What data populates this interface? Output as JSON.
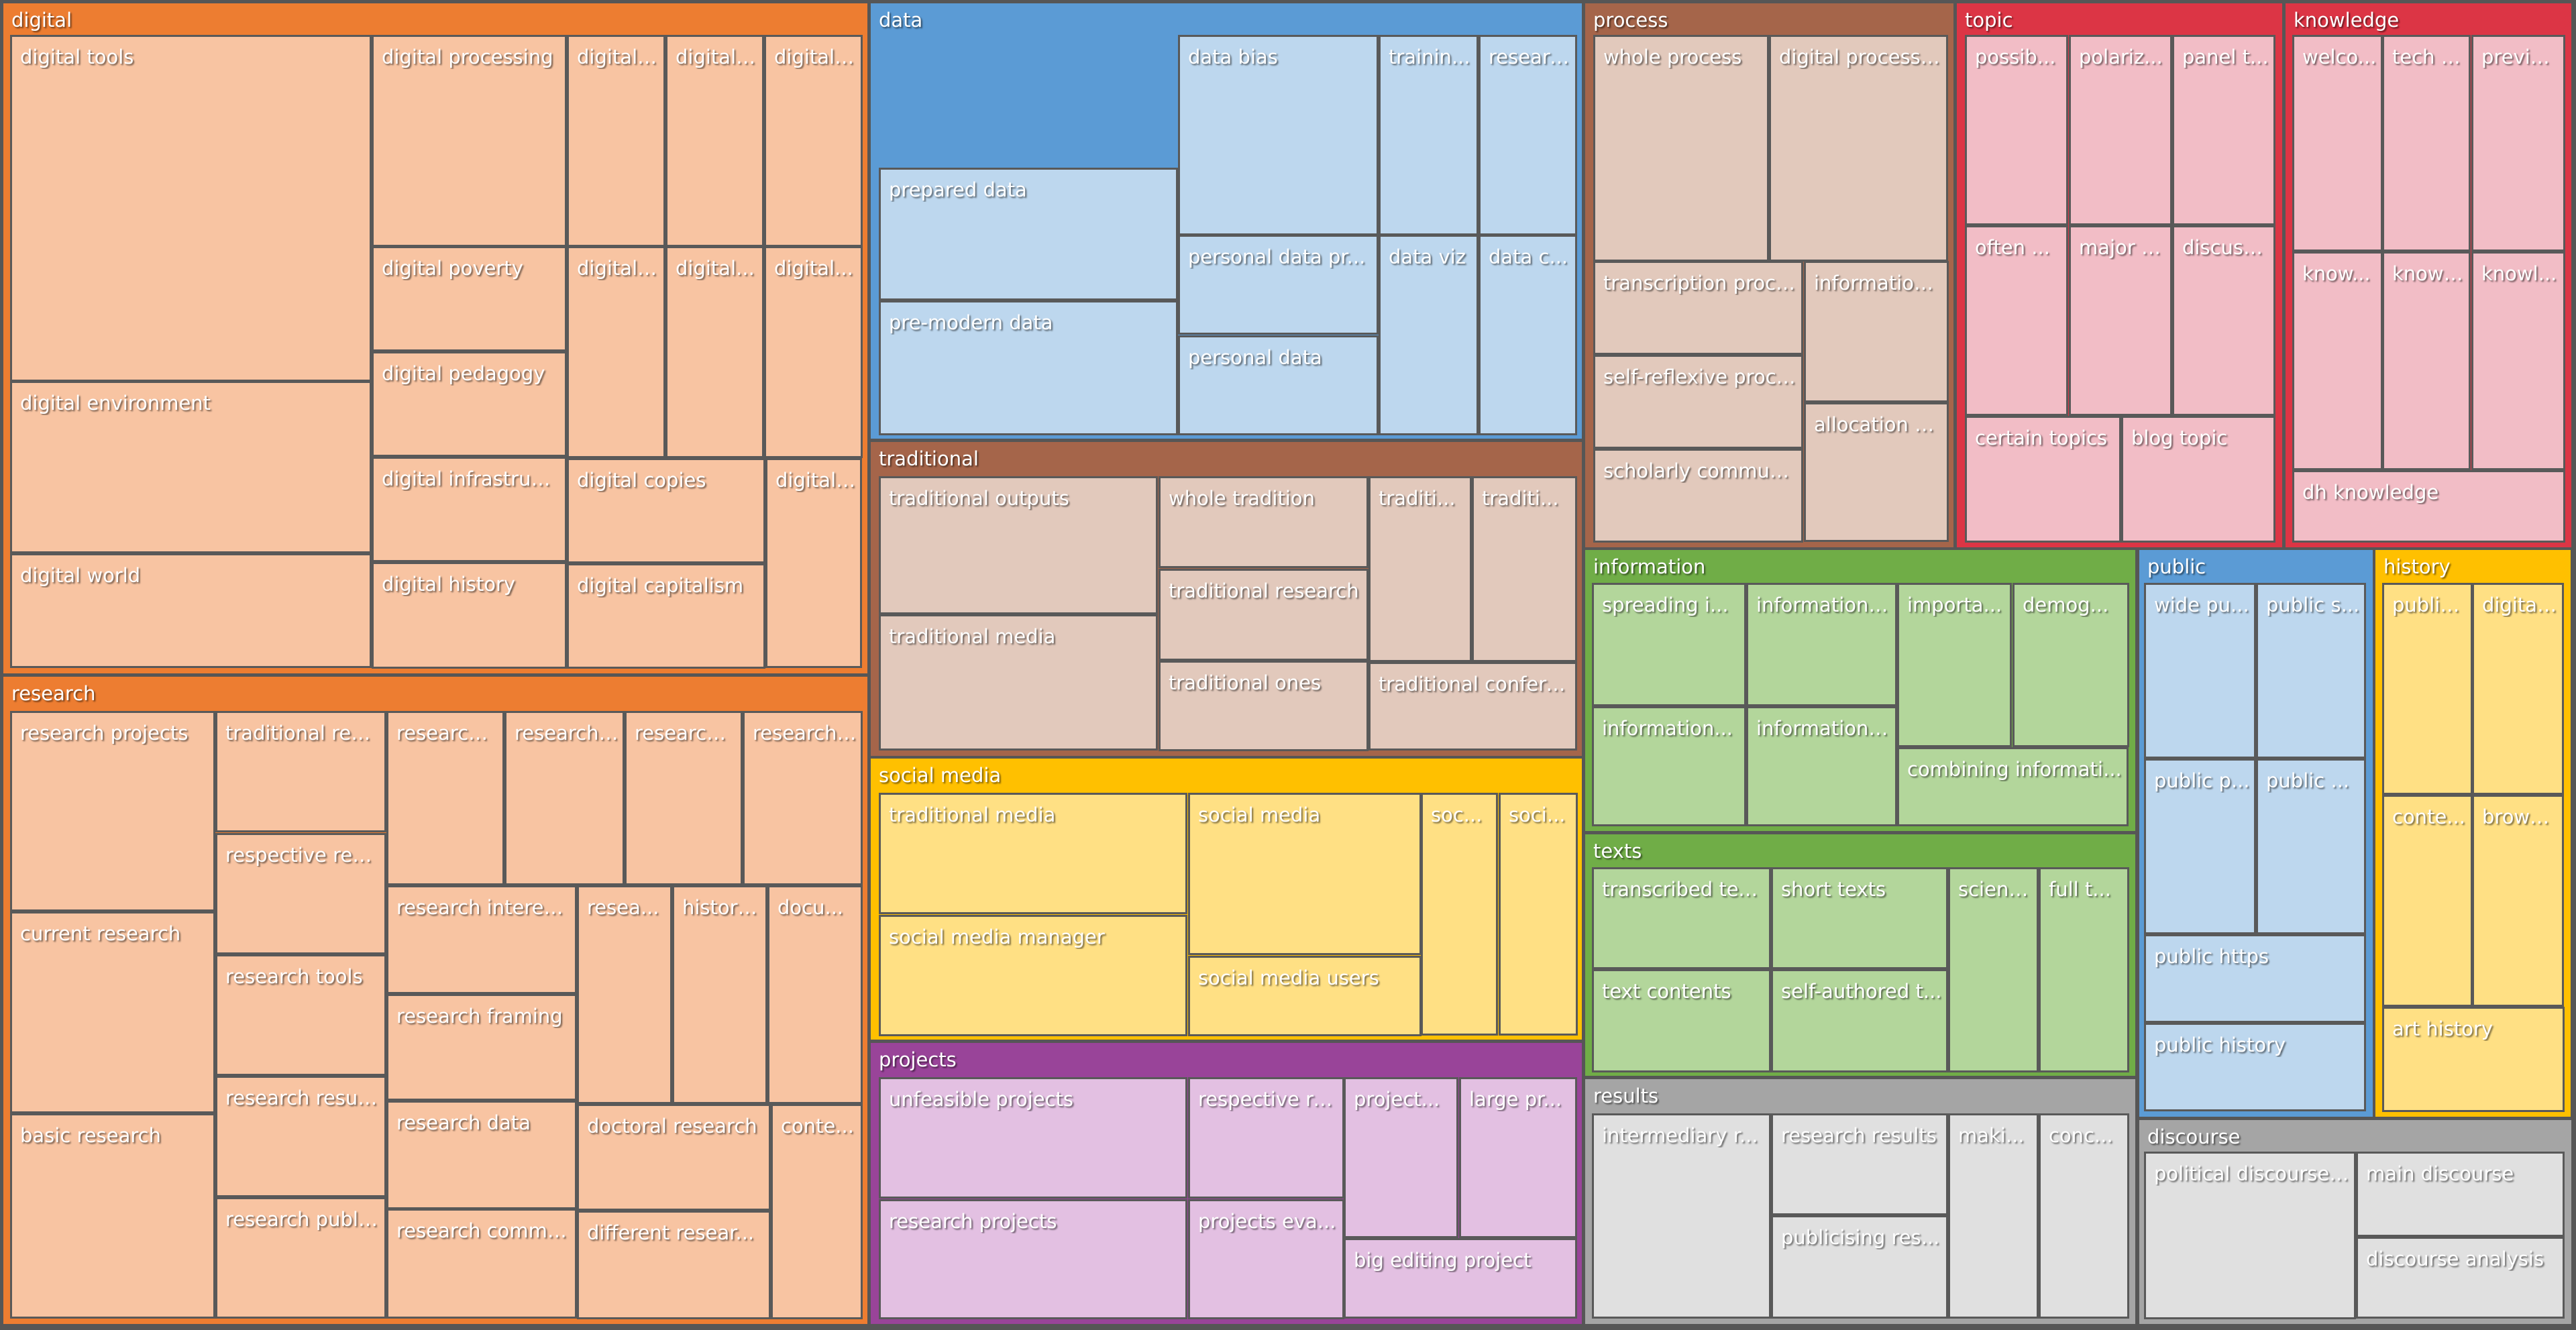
{
  "chart_data": {
    "type": "treemap",
    "title": "",
    "groups": [
      {
        "name": "digital",
        "color": "#ED7D31",
        "leaf_color": "#F8C4A2",
        "children": [
          "digital tools",
          "digital processing",
          "digital ...",
          "digital ...",
          "digital ...",
          "digital environment",
          "digital world",
          "digital poverty",
          "digital pedagogy",
          "digital infrastruct...",
          "digital history",
          "digital ...",
          "digital...",
          "digital...",
          "digital copies",
          "digital capitalism",
          "digital ..."
        ]
      },
      {
        "name": "research",
        "color": "#ED7D31",
        "leaf_color": "#F8C4A2",
        "children": [
          "research projects",
          "current research",
          "basic research",
          "traditional rese...",
          "respective rese...",
          "research tools",
          "research results",
          "research publis...",
          "research ...",
          "research ...",
          "research ...",
          "research j...",
          "research interests",
          "research framing",
          "research data",
          "research commu...",
          "resea...",
          "histori...",
          "docu...",
          "doctoral research",
          "different resear...",
          "conte..."
        ]
      },
      {
        "name": "data",
        "color": "#5B9BD5",
        "leaf_color": "#BDD7EE",
        "children": [
          "prepared data",
          "pre-modern data",
          "data bias",
          "personal data pr...",
          "personal data",
          "trainin...",
          "researc...",
          "data viz",
          "data c..."
        ]
      },
      {
        "name": "traditional",
        "color": "#A5654A",
        "leaf_color": "#E2C9BC",
        "children": [
          "traditional outputs",
          "traditional media",
          "whole tradition",
          "traditional research",
          "traditional ones",
          "traditi...",
          "traditi...",
          "traditional confere..."
        ]
      },
      {
        "name": "social media",
        "color": "#FFC000",
        "leaf_color": "#FFE084",
        "children": [
          "traditional media",
          "social media manager",
          "social media",
          "social media users",
          "soc...",
          "soci..."
        ]
      },
      {
        "name": "projects",
        "color": "#994499",
        "leaf_color": "#E3C0E2",
        "children": [
          "unfeasible projects",
          "research projects",
          "respective re...",
          "projects eva...",
          "project...",
          "large pr...",
          "big editing project"
        ]
      },
      {
        "name": "process",
        "color": "#A5654A",
        "leaf_color": "#E2C9BC",
        "children": [
          "whole process",
          "digital processi...",
          "transcription process",
          "self-reflexive process",
          "scholarly communi...",
          "information ...",
          "allocation p..."
        ]
      },
      {
        "name": "topic",
        "color": "#DC3545",
        "leaf_color": "#F2BDC6",
        "children": [
          "possib...",
          "polariz...",
          "panel t...",
          "often ...",
          "major t...",
          "discussi...",
          "certain topics",
          "blog topic"
        ]
      },
      {
        "name": "knowledge",
        "color": "#DC3545",
        "leaf_color": "#F2BDC6",
        "children": [
          "welco...",
          "tech k...",
          "previo...",
          "know...",
          "knowl...",
          "knowl...",
          "dh knowledge"
        ]
      },
      {
        "name": "information",
        "color": "#70AD47",
        "leaf_color": "#B3D69B",
        "children": [
          "spreading i...",
          "information ...",
          "information...",
          "information ...",
          "importa...",
          "demog...",
          "combining informati..."
        ]
      },
      {
        "name": "texts",
        "color": "#70AD47",
        "leaf_color": "#B3D69B",
        "children": [
          "transcribed texts",
          "text contents",
          "short texts",
          "self-authored t...",
          "scient...",
          "full t..."
        ]
      },
      {
        "name": "results",
        "color": "#A5A5A5",
        "leaf_color": "#E0E0E0",
        "children": [
          "intermediary r...",
          "research results",
          "publicising res...",
          "maki...",
          "conc..."
        ]
      },
      {
        "name": "public",
        "color": "#5B9BD5",
        "leaf_color": "#BDD7EE",
        "children": [
          "wide pu...",
          "public s...",
          "public p...",
          "public ...",
          "public https",
          "public history"
        ]
      },
      {
        "name": "history",
        "color": "#FFC000",
        "leaf_color": "#FFE084",
        "children": [
          "public...",
          "digital...",
          "conte...",
          "brows...",
          "art history"
        ]
      },
      {
        "name": "discourse",
        "color": "#A5A5A5",
        "leaf_color": "#E0E0E0",
        "children": [
          "political discourse ...",
          "main discourse",
          "discourse analysis"
        ]
      }
    ]
  }
}
